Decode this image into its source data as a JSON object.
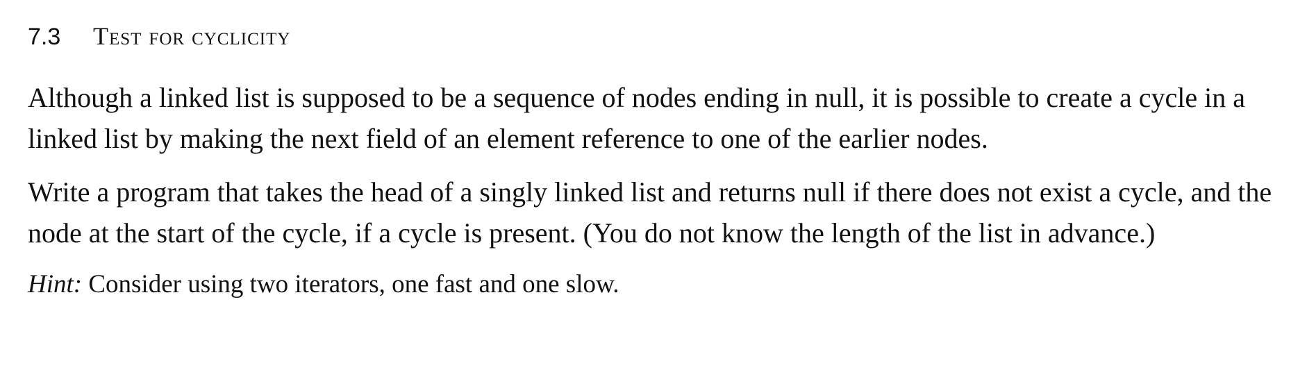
{
  "section": {
    "number": "7.3",
    "title": "Test for cyclicity"
  },
  "paragraphs": [
    "Although a linked list is supposed to be a sequence of nodes ending in null, it is possible to create a cycle in a linked list by making the next field of an element reference to one of the earlier nodes.",
    "Write a program that takes the head of a singly linked list and returns null if there does not exist a cycle, and the node at the start of the cycle, if a cycle is present. (You do not know the length of the list in advance.)"
  ],
  "hint": {
    "label": "Hint:",
    "text": " Consider using two iterators, one fast and one slow."
  }
}
